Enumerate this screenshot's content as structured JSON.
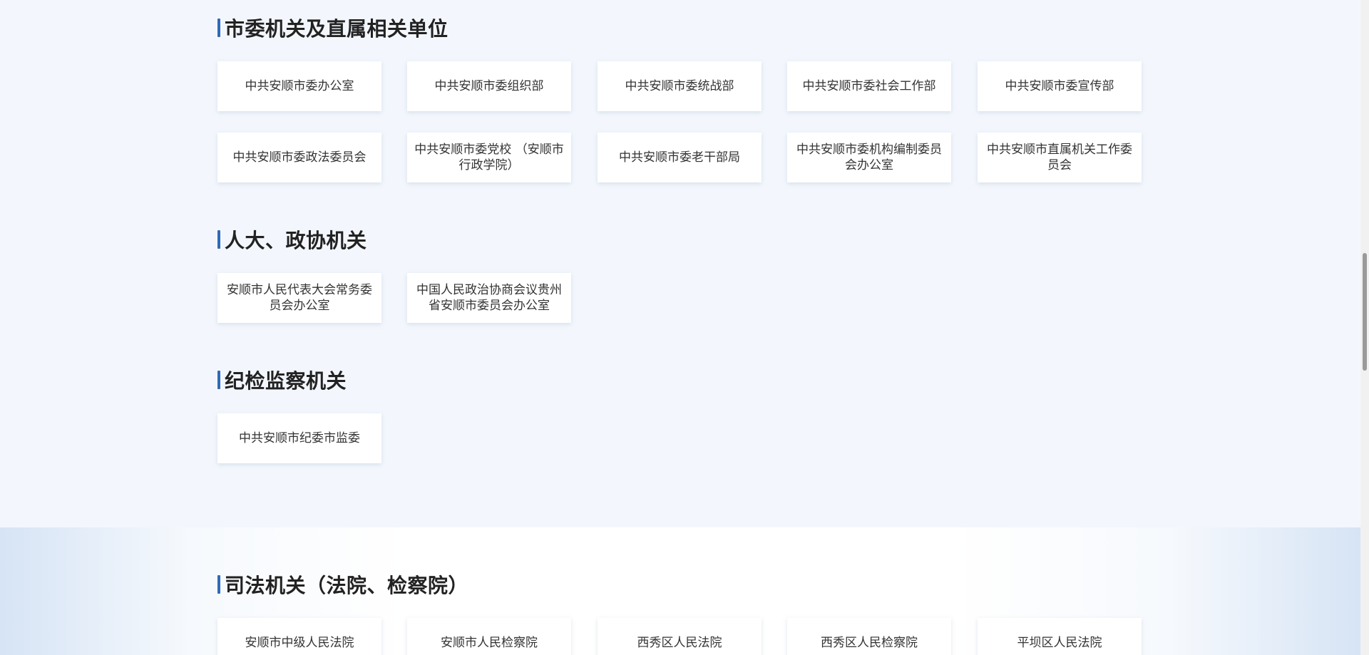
{
  "sections": [
    {
      "title": "市委机关及直属相关单位",
      "items": [
        "中共安顺市委办公室",
        "中共安顺市委组织部",
        "中共安顺市委统战部",
        "中共安顺市委社会工作部",
        "中共安顺市委宣传部",
        "中共安顺市委政法委员会",
        "中共安顺市委党校 （安顺市行政学院）",
        "中共安顺市委老干部局",
        "中共安顺市委机构编制委员会办公室",
        "中共安顺市直属机关工作委员会"
      ]
    },
    {
      "title": "人大、政协机关",
      "items": [
        "安顺市人民代表大会常务委员会办公室",
        "中国人民政治协商会议贵州省安顺市委员会办公室"
      ]
    },
    {
      "title": "纪检监察机关",
      "items": [
        "中共安顺市纪委市监委"
      ]
    },
    {
      "title": "司法机关（法院、检察院）",
      "items": [
        "安顺市中级人民法院",
        "安顺市人民检察院",
        "西秀区人民法院",
        "西秀区人民检察院",
        "平坝区人民法院"
      ]
    }
  ],
  "colors": {
    "accent_bar": "#2e6bb7",
    "page_bg": "#f3f7fd",
    "card_bg": "#ffffff"
  }
}
